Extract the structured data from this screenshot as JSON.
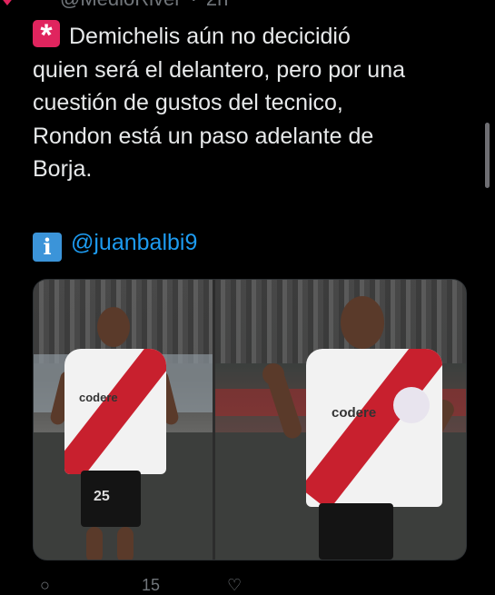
{
  "header": {
    "handle": "@MedioRiver",
    "separator": "·",
    "time": "2h"
  },
  "tweet": {
    "lines": [
      "Demichelis aún no decicidió",
      "quien será el delantero, pero por una",
      "cuestión de gustos del tecnico,",
      "Rondon está un paso adelante de",
      "Borja."
    ],
    "lead_icon": "police-siren-emoji",
    "source_icon": "information-emoji",
    "mention": "@juanbalbi9"
  },
  "media": {
    "left_jersey_number": "25",
    "left_sponsor": "codere",
    "right_sponsor": "codere"
  },
  "colors": {
    "background": "#000000",
    "text": "#e7e9ea",
    "mention": "#1d9bf0",
    "muted": "#71767b",
    "siren": "#e0245e",
    "info": "#3b94d9",
    "river_red": "#c8202e"
  },
  "actions": {
    "like_count": "15"
  }
}
